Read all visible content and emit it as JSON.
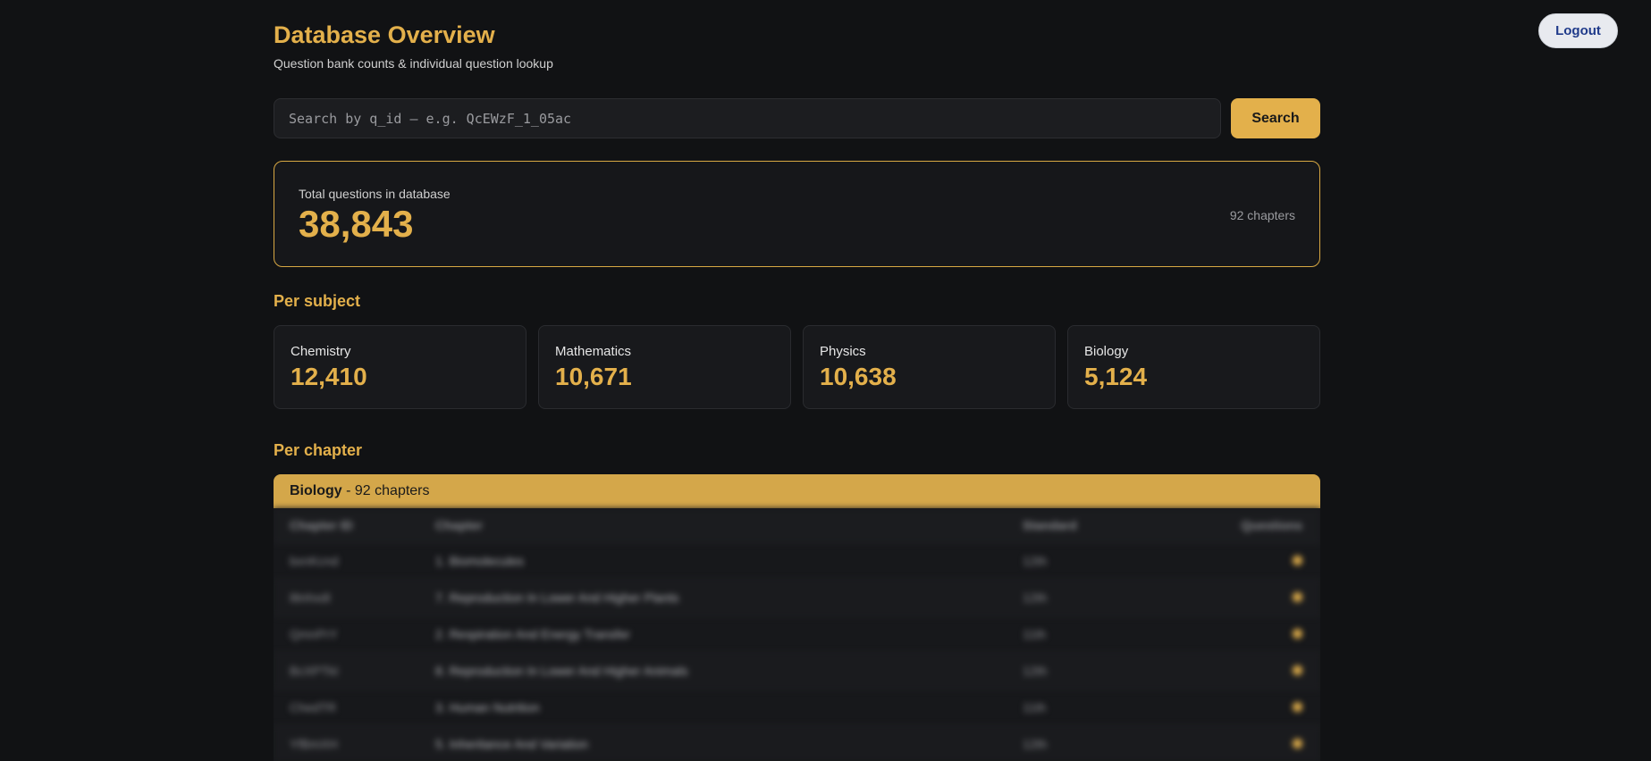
{
  "header": {
    "title": "Database Overview",
    "subtitle": "Question bank counts & individual question lookup",
    "logout_label": "Logout"
  },
  "search": {
    "placeholder": "Search by q_id – e.g. QcEWzF_1_05ac",
    "button_label": "Search"
  },
  "totals": {
    "label": "Total questions in database",
    "value": "38,843",
    "chapters": "92 chapters"
  },
  "per_subject": {
    "title": "Per subject",
    "items": [
      {
        "name": "Chemistry",
        "count": "12,410"
      },
      {
        "name": "Mathematics",
        "count": "10,671"
      },
      {
        "name": "Physics",
        "count": "10,638"
      },
      {
        "name": "Biology",
        "count": "5,124"
      }
    ]
  },
  "per_chapter": {
    "title": "Per chapter",
    "group_subject": "Biology",
    "group_suffix": "- 92 chapters",
    "columns": [
      "Chapter ID",
      "Chapter",
      "Standard",
      "Questions"
    ],
    "rows": [
      {
        "id": "bxnKcnd",
        "chapter": "1. Biomolecules",
        "standard": "12th"
      },
      {
        "id": "8tnhxdI",
        "chapter": "7. Reproduction In Lower And Higher Plants",
        "standard": "12th"
      },
      {
        "id": "QmnPrY",
        "chapter": "2. Respiration And Energy Transfer",
        "standard": "11th"
      },
      {
        "id": "BcXPTkI",
        "chapter": "8. Reproduction In Lower And Higher Animals",
        "standard": "12th"
      },
      {
        "id": "ChedTR",
        "chapter": "3. Human Nutrition",
        "standard": "11th"
      },
      {
        "id": "YfBmXH",
        "chapter": "5. Inheritance And Variation",
        "standard": "12th"
      }
    ]
  },
  "colors": {
    "accent": "#e3b04b",
    "background": "#111214",
    "card": "#18191c"
  }
}
